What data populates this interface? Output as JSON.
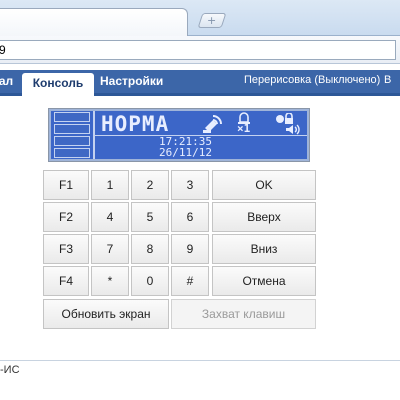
{
  "browser": {
    "new_tab_symbol": "+",
    "address_value": "9"
  },
  "navbar": {
    "left_cut_label": "ал",
    "tabs": [
      {
        "label": "Консоль",
        "active": true
      },
      {
        "label": "Настройки",
        "active": false
      }
    ],
    "status": "Перерисовка (Выключено)",
    "right_cut_label": "В"
  },
  "lcd": {
    "status_text": "НОРМА",
    "icons": [
      "satellite-icon",
      "bell-icon",
      "lock-icon",
      "speaker-icon"
    ],
    "counter_label": "×1",
    "time": "17:21:35",
    "date": "26/11/12"
  },
  "keypad": {
    "keys": [
      {
        "label": "F1",
        "name": "key-f1"
      },
      {
        "label": "1",
        "name": "key-1"
      },
      {
        "label": "2",
        "name": "key-2"
      },
      {
        "label": "3",
        "name": "key-3"
      },
      {
        "label": "OK",
        "name": "key-ok"
      },
      {
        "label": "F2",
        "name": "key-f2"
      },
      {
        "label": "4",
        "name": "key-4"
      },
      {
        "label": "5",
        "name": "key-5"
      },
      {
        "label": "6",
        "name": "key-6"
      },
      {
        "label": "Вверх",
        "name": "key-up"
      },
      {
        "label": "F3",
        "name": "key-f3"
      },
      {
        "label": "7",
        "name": "key-7"
      },
      {
        "label": "8",
        "name": "key-8"
      },
      {
        "label": "9",
        "name": "key-9"
      },
      {
        "label": "Вниз",
        "name": "key-down"
      },
      {
        "label": "F4",
        "name": "key-f4"
      },
      {
        "label": "*",
        "name": "key-star"
      },
      {
        "label": "0",
        "name": "key-0"
      },
      {
        "label": "#",
        "name": "key-hash"
      },
      {
        "label": "Отмена",
        "name": "key-cancel"
      }
    ],
    "refresh_label": "Обновить экран",
    "capture_label": "Захват клавиш",
    "capture_disabled": true
  },
  "statusbar": {
    "text": "-ИС"
  },
  "colors": {
    "navbar": "#3c66a8",
    "lcd_background": "#3c66c8",
    "lcd_text": "#e8eeff"
  }
}
